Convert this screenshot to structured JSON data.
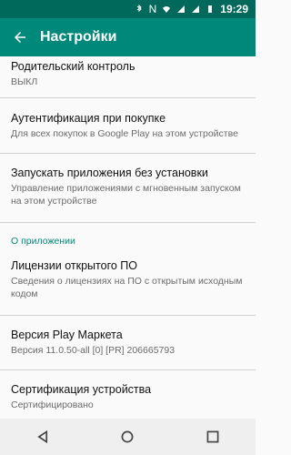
{
  "status_bar": {
    "time": "19:29",
    "icons": [
      "bluetooth-icon",
      "n-icon",
      "wifi-icon",
      "signal-icon",
      "signal-icon",
      "battery-icon"
    ],
    "extra": "N"
  },
  "app_bar": {
    "title": "Настройки",
    "back_icon": "arrow-back-icon"
  },
  "settings": {
    "items": [
      {
        "title": "Родительский контроль",
        "summary": "ВЫКЛ"
      },
      {
        "title": "Аутентификация при покупке",
        "summary": "Для всех покупок в Google Play на этом устройстве"
      },
      {
        "title": "Запускать приложения без установки",
        "summary": "Управление приложениями с мгновенным запуском на этом устройстве"
      },
      {
        "title": "Лицензии открытого ПО",
        "summary": "Сведения о лицензиях на ПО с открытым исходным кодом"
      },
      {
        "title": "Версия Play Маркета",
        "summary": "Версия 11.0.50-all [0] [PR] 206665793"
      },
      {
        "title": "Сертификация устройства",
        "summary": "Сертифицировано"
      }
    ],
    "section_about": "О приложении"
  },
  "colors": {
    "accent": "#00897b",
    "status_bar": "#00695c"
  }
}
